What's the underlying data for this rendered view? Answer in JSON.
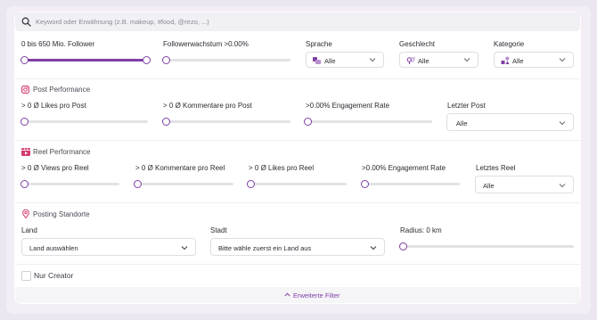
{
  "search": {
    "placeholder": "Keyword oder Erwähnung (z.B. makeup, #food, @rezo, ...)"
  },
  "filters": {
    "follower": {
      "label": "0 bis 650 Mio. Follower",
      "min_fraction": 0.0,
      "max_fraction": 1.0
    },
    "growth": {
      "label": "Followerwachstum >0.00%",
      "fraction": 0.0
    },
    "language": {
      "label": "Sprache",
      "value": "Alle",
      "icon": "language-icon"
    },
    "gender": {
      "label": "Geschlecht",
      "value": "Alle",
      "icon": "gender-icon"
    },
    "category": {
      "label": "Kategorie",
      "value": "Alle",
      "icon": "category-icon"
    }
  },
  "post_performance": {
    "title": "Post Performance",
    "icon": "instagram-icon",
    "likes": {
      "label": "> 0 Ø Likes pro Post",
      "fraction": 0.0
    },
    "comments": {
      "label": "> 0 Ø Kommentare pro Post",
      "fraction": 0.0
    },
    "engagement": {
      "label": ">0.00% Engagement Rate",
      "fraction": 0.0
    },
    "last_post": {
      "label": "Letzter Post",
      "value": "Alle"
    }
  },
  "reel_performance": {
    "title": "Reel Performance",
    "icon": "reel-icon",
    "views": {
      "label": "> 0 Ø Views pro Reel",
      "fraction": 0.0
    },
    "comments": {
      "label": "> 0 Ø Kommentare pro Reel",
      "fraction": 0.0
    },
    "likes": {
      "label": "> 0 Ø Likes pro Reel",
      "fraction": 0.0
    },
    "engagement": {
      "label": ">0.00% Engagement Rate",
      "fraction": 0.0
    },
    "last_reel": {
      "label": "Letztes Reel",
      "value": "Alle"
    }
  },
  "locations": {
    "title": "Posting Standorte",
    "icon": "map-pin-icon",
    "country": {
      "label": "Land",
      "value": "Land auswählen"
    },
    "city": {
      "label": "Stadt",
      "value": "Bitte wähle zuerst ein Land aus"
    },
    "radius": {
      "label": "Radius: 0 km",
      "fraction": 0.0
    }
  },
  "only_creator": {
    "label": "Nur Creator",
    "checked": false
  },
  "advanced_filters": {
    "label": "Erweiterte Filter"
  },
  "colors": {
    "accent": "#7e3fa6",
    "track": "#e3e3e7",
    "background": "#ece6f1"
  }
}
